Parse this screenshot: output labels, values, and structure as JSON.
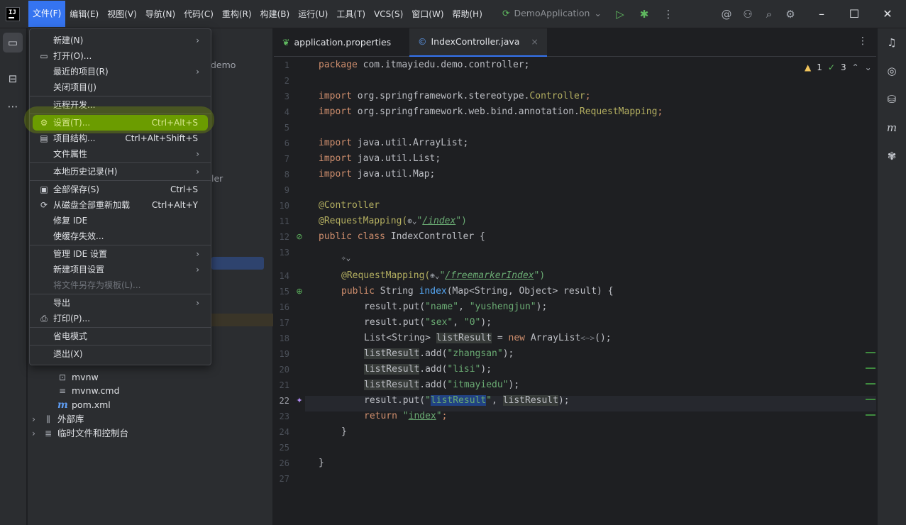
{
  "titlebar": {
    "logo": "IJ",
    "menus": [
      "文件(F)",
      "编辑(E)",
      "视图(V)",
      "导航(N)",
      "代码(C)",
      "重构(R)",
      "构建(B)",
      "运行(U)",
      "工具(T)",
      "VCS(S)",
      "窗口(W)",
      "帮助(H)"
    ],
    "run_config": "DemoApplication"
  },
  "project": {
    "partial_demo": "demo",
    "partial_ler": "ler",
    "tree": [
      {
        "label": "mvnw",
        "icon": "terminal-icon"
      },
      {
        "label": "mvnw.cmd",
        "icon": "text-file-icon"
      },
      {
        "label": "pom.xml",
        "icon": "maven-icon"
      },
      {
        "label": "外部库",
        "icon": "library-icon"
      },
      {
        "label": "临时文件和控制台",
        "icon": "scratch-icon"
      }
    ]
  },
  "tabs": [
    {
      "label": "application.properties",
      "active": false
    },
    {
      "label": "IndexController.java",
      "active": true
    }
  ],
  "inspections": {
    "warnings": "1",
    "checks": "3"
  },
  "line_numbers": [
    "1",
    "2",
    "3",
    "4",
    "5",
    "6",
    "7",
    "8",
    "9",
    "10",
    "11",
    "12",
    "13",
    "14",
    "15",
    "16",
    "17",
    "18",
    "19",
    "20",
    "21",
    "22",
    "23",
    "24",
    "25",
    "26",
    "27"
  ],
  "code": {
    "l1_kw": "package",
    "l1_rest": " com.itmayiedu.demo.controller;",
    "l3_kw": "import",
    "l3_pkg": " org.springframework.stereotype.",
    "l3_cls": "Controller",
    "l3_end": ";",
    "l4_kw": "import",
    "l4_pkg": " org.springframework.web.bind.annotation.",
    "l4_cls": "RequestMapping",
    "l4_end": ";",
    "l6_kw": "import",
    "l6_rest": " java.util.ArrayList;",
    "l7_kw": "import",
    "l7_rest": " java.util.List;",
    "l8_kw": "import",
    "l8_rest": " java.util.Map;",
    "l10": "@Controller",
    "l11_an": "@RequestMapping(",
    "l11_q": "\"",
    "l11_url": "/index",
    "l11_end": "\")",
    "l12_kw": "public class",
    "l12_rest": " IndexController {",
    "l14_an": "@RequestMapping(",
    "l14_q": "\"",
    "l14_url": "/freemarkerIndex",
    "l14_end": "\")",
    "l15_kw": "public",
    "l15_t": " String ",
    "l15_fn": "index",
    "l15_rest": "(Map<String, Object> result) {",
    "l16_a": "result.put(",
    "l16_s1": "\"name\"",
    "l16_m": ", ",
    "l16_s2": "\"yushengjun\"",
    "l16_e": ");",
    "l17_a": "result.put(",
    "l17_s1": "\"sex\"",
    "l17_m": ", ",
    "l17_s2": "\"0\"",
    "l17_e": ");",
    "l18_a": "List<String> ",
    "l18_v": "listResult",
    "l18_b": " = ",
    "l18_kw": "new",
    "l18_c": " ArrayList",
    "l18_d": "<~>",
    "l18_e": "();",
    "l19_v": "listResult",
    "l19_a": ".add(",
    "l19_s": "\"zhangsan\"",
    "l19_e": ");",
    "l20_v": "listResult",
    "l20_a": ".add(",
    "l20_s": "\"lisi\"",
    "l20_e": ");",
    "l21_v": "listResult",
    "l21_a": ".add(",
    "l21_s": "\"itmayiedu\"",
    "l21_e": ");",
    "l22_a": "result.put(",
    "l22_q1": "\"",
    "l22_sel": "listResult",
    "l22_q2": "\"",
    "l22_m": ", ",
    "l22_v": "listResult",
    "l22_e": ");",
    "l23_kw": "return",
    "l23_sp": " ",
    "l23_q1": "\"",
    "l23_s": "index",
    "l23_q2": "\"",
    "l23_e": ";",
    "l24": "}",
    "l26": "}"
  },
  "file_menu": {
    "new": "新建(N)",
    "open": "打开(O)...",
    "recent": "最近的项目(R)",
    "close": "关闭项目(J)",
    "remote": "远程开发...",
    "settings": "设置(T)...",
    "settings_sc": "Ctrl+Alt+S",
    "structure": "项目结构...",
    "structure_sc": "Ctrl+Alt+Shift+S",
    "file_props": "文件属性",
    "local_history": "本地历史记录(H)",
    "save_all": "全部保存(S)",
    "save_all_sc": "Ctrl+S",
    "reload": "从磁盘全部重新加载",
    "reload_sc": "Ctrl+Alt+Y",
    "repair": "修复 IDE",
    "invalidate": "使缓存失效...",
    "manage_ide": "管理 IDE 设置",
    "new_proj_settings": "新建项目设置",
    "save_template": "将文件另存为模板(L)...",
    "export": "导出",
    "print": "打印(P)...",
    "power_save": "省电模式",
    "exit": "退出(X)"
  }
}
